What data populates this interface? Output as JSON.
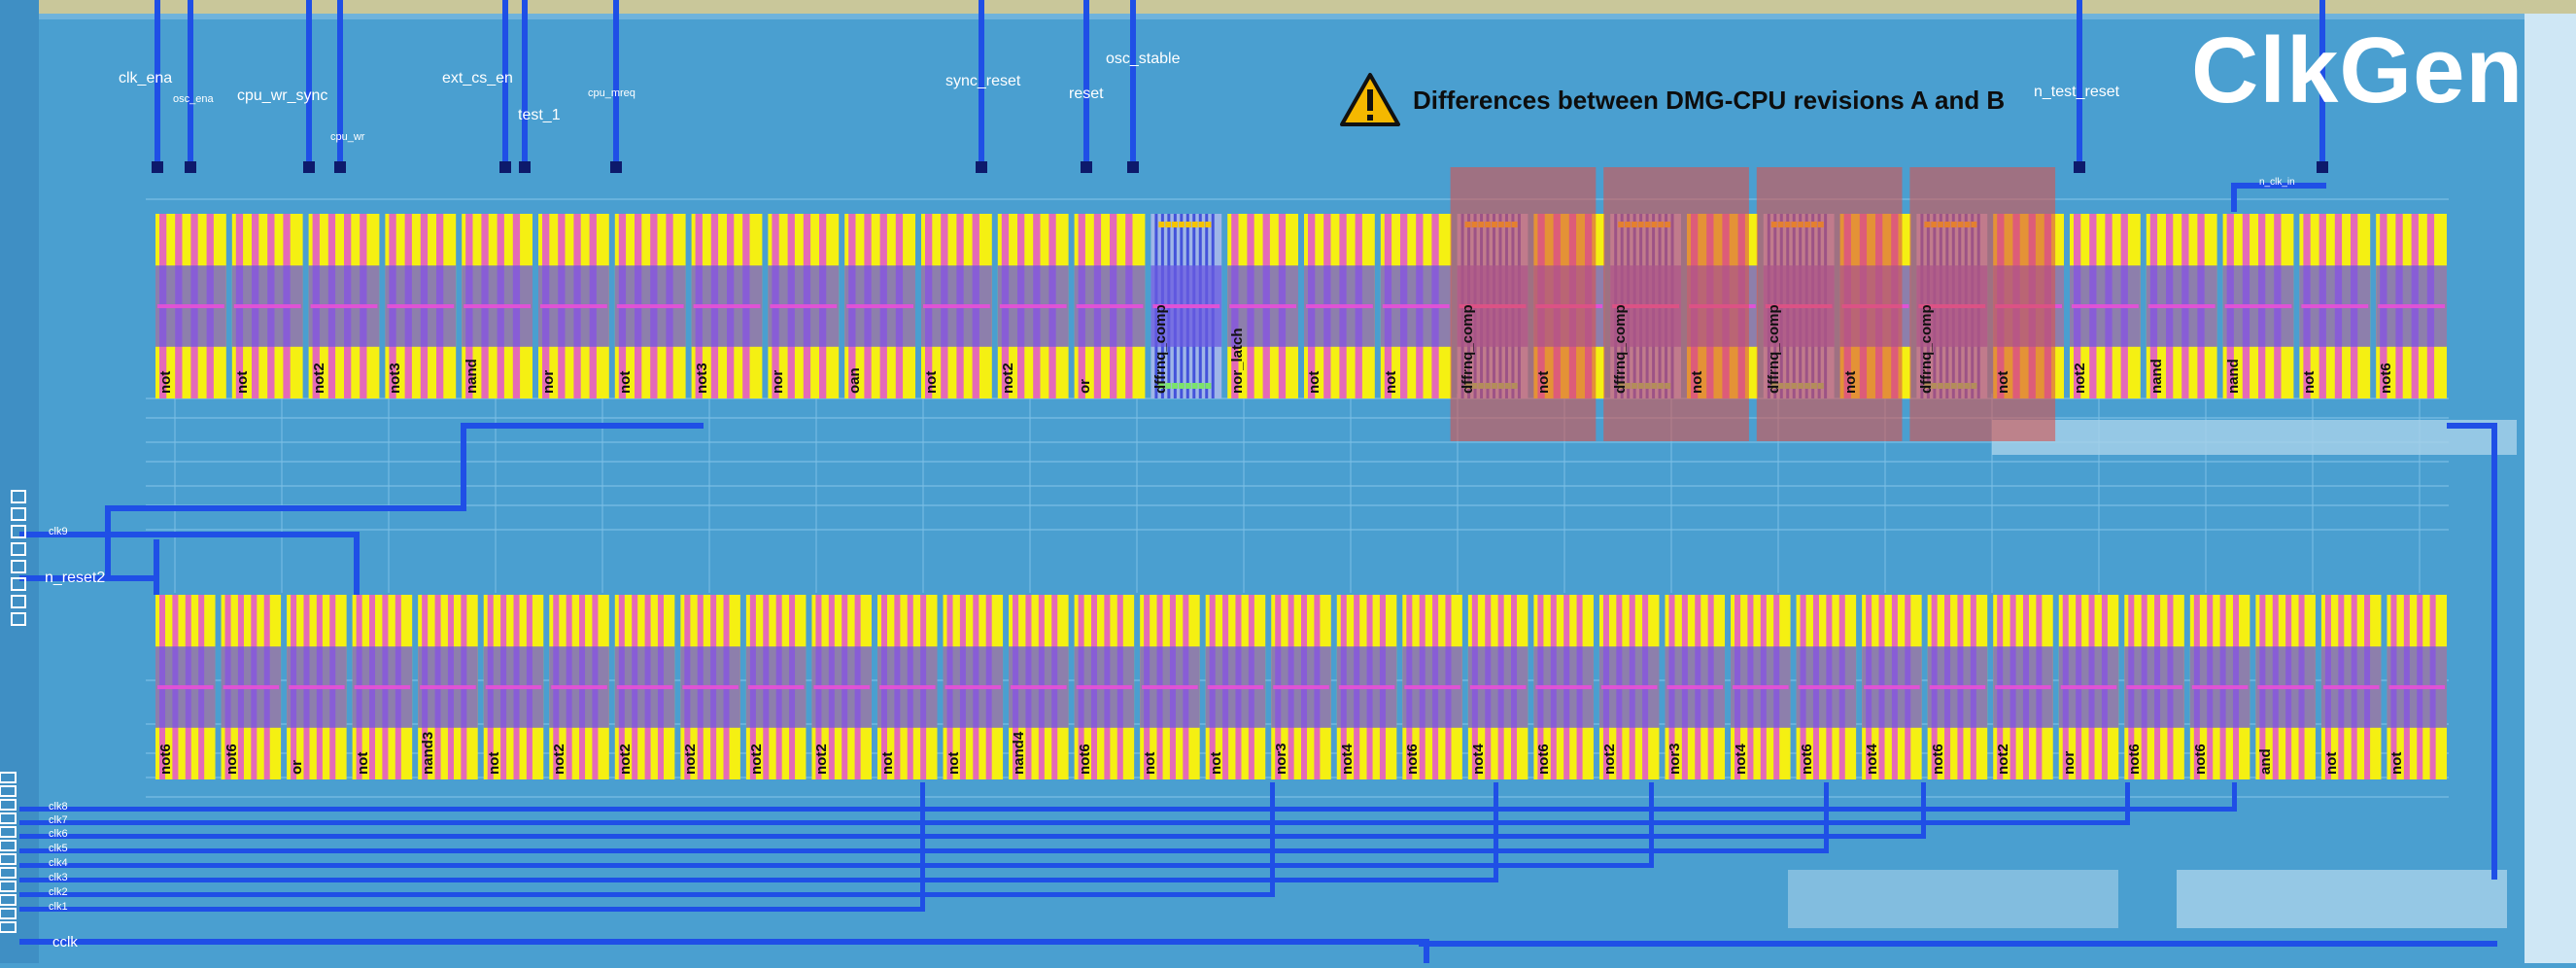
{
  "title": "ClkGen",
  "notice": {
    "icon": "warning-icon",
    "text": "Differences between DMG-CPU revisions A and B",
    "highlight_color": "#d9534f"
  },
  "top_signals": [
    {
      "id": "clk_ena",
      "label": "clk_ena",
      "size": "md"
    },
    {
      "id": "osc_ena",
      "label": "osc_ena",
      "size": "sm"
    },
    {
      "id": "cpu_wr_sync",
      "label": "cpu_wr_sync",
      "size": "md"
    },
    {
      "id": "cpu_wr",
      "label": "cpu_wr",
      "size": "sm"
    },
    {
      "id": "ext_cs_en",
      "label": "ext_cs_en",
      "size": "md"
    },
    {
      "id": "test_1",
      "label": "test_1",
      "size": "md"
    },
    {
      "id": "cpu_mreq",
      "label": "cpu_mreq",
      "size": "sm"
    },
    {
      "id": "sync_reset",
      "label": "sync_reset",
      "size": "md"
    },
    {
      "id": "reset",
      "label": "reset",
      "size": "md"
    },
    {
      "id": "osc_stable",
      "label": "osc_stable",
      "size": "md"
    },
    {
      "id": "n_test_reset",
      "label": "n_test_reset",
      "size": "md"
    },
    {
      "id": "n_clk_in",
      "label": "n_clk_in",
      "size": "sm"
    }
  ],
  "left_signals": [
    {
      "id": "clk9",
      "label": "clk9"
    },
    {
      "id": "n_reset2",
      "label": "n_reset2"
    }
  ],
  "bottom_left_signals": [
    "clk8",
    "clk7",
    "clk6",
    "clk5",
    "clk4",
    "clk3",
    "clk2",
    "clk1",
    "cclk"
  ],
  "row1_cells": [
    {
      "label": "not"
    },
    {
      "label": "not"
    },
    {
      "label": "not2"
    },
    {
      "label": "not3"
    },
    {
      "label": "nand"
    },
    {
      "label": "nor"
    },
    {
      "label": "not"
    },
    {
      "label": "not3"
    },
    {
      "label": "nor"
    },
    {
      "label": "oan"
    },
    {
      "label": "not"
    },
    {
      "label": "not2"
    },
    {
      "label": "or"
    },
    {
      "label": "dffrnq_comp"
    },
    {
      "label": "nor_latch"
    },
    {
      "label": "not"
    },
    {
      "label": "not"
    },
    {
      "label": "dffrnq_comp",
      "highlight": true
    },
    {
      "label": "not"
    },
    {
      "label": "dffrnq_comp",
      "highlight": true
    },
    {
      "label": "not"
    },
    {
      "label": "dffrnq_comp",
      "highlight": true
    },
    {
      "label": "not"
    },
    {
      "label": "dffrnq_comp",
      "highlight": true
    },
    {
      "label": "not"
    },
    {
      "label": "not2"
    },
    {
      "label": "nand"
    },
    {
      "label": "nand"
    },
    {
      "label": "not"
    },
    {
      "label": "not6"
    }
  ],
  "row2_cells": [
    {
      "label": "not6"
    },
    {
      "label": "not6"
    },
    {
      "label": "or"
    },
    {
      "label": "not"
    },
    {
      "label": "nand3"
    },
    {
      "label": "not"
    },
    {
      "label": "not2"
    },
    {
      "label": "not2"
    },
    {
      "label": "not2"
    },
    {
      "label": "not2"
    },
    {
      "label": "not2"
    },
    {
      "label": "not"
    },
    {
      "label": "not"
    },
    {
      "label": "nand4"
    },
    {
      "label": "not6"
    },
    {
      "label": "not"
    },
    {
      "label": "not"
    },
    {
      "label": "nor3"
    },
    {
      "label": "not4"
    },
    {
      "label": "not6"
    },
    {
      "label": "not4"
    },
    {
      "label": "not6"
    },
    {
      "label": "not2"
    },
    {
      "label": "nor3"
    },
    {
      "label": "not4"
    },
    {
      "label": "not6"
    },
    {
      "label": "not4"
    },
    {
      "label": "not6"
    },
    {
      "label": "not2"
    },
    {
      "label": "nor"
    },
    {
      "label": "not6"
    },
    {
      "label": "not6"
    },
    {
      "label": "and"
    },
    {
      "label": "not"
    },
    {
      "label": "not"
    }
  ],
  "colors": {
    "die_background": "#4a9fd0",
    "cell_yellow": "#f5f012",
    "cell_magenta": "#e052d6",
    "cell_purple": "#6a5ae0",
    "metal_blue": "#1f4fe6",
    "poly_lilac": "#b08ae0",
    "highlight": "#d9534f"
  }
}
